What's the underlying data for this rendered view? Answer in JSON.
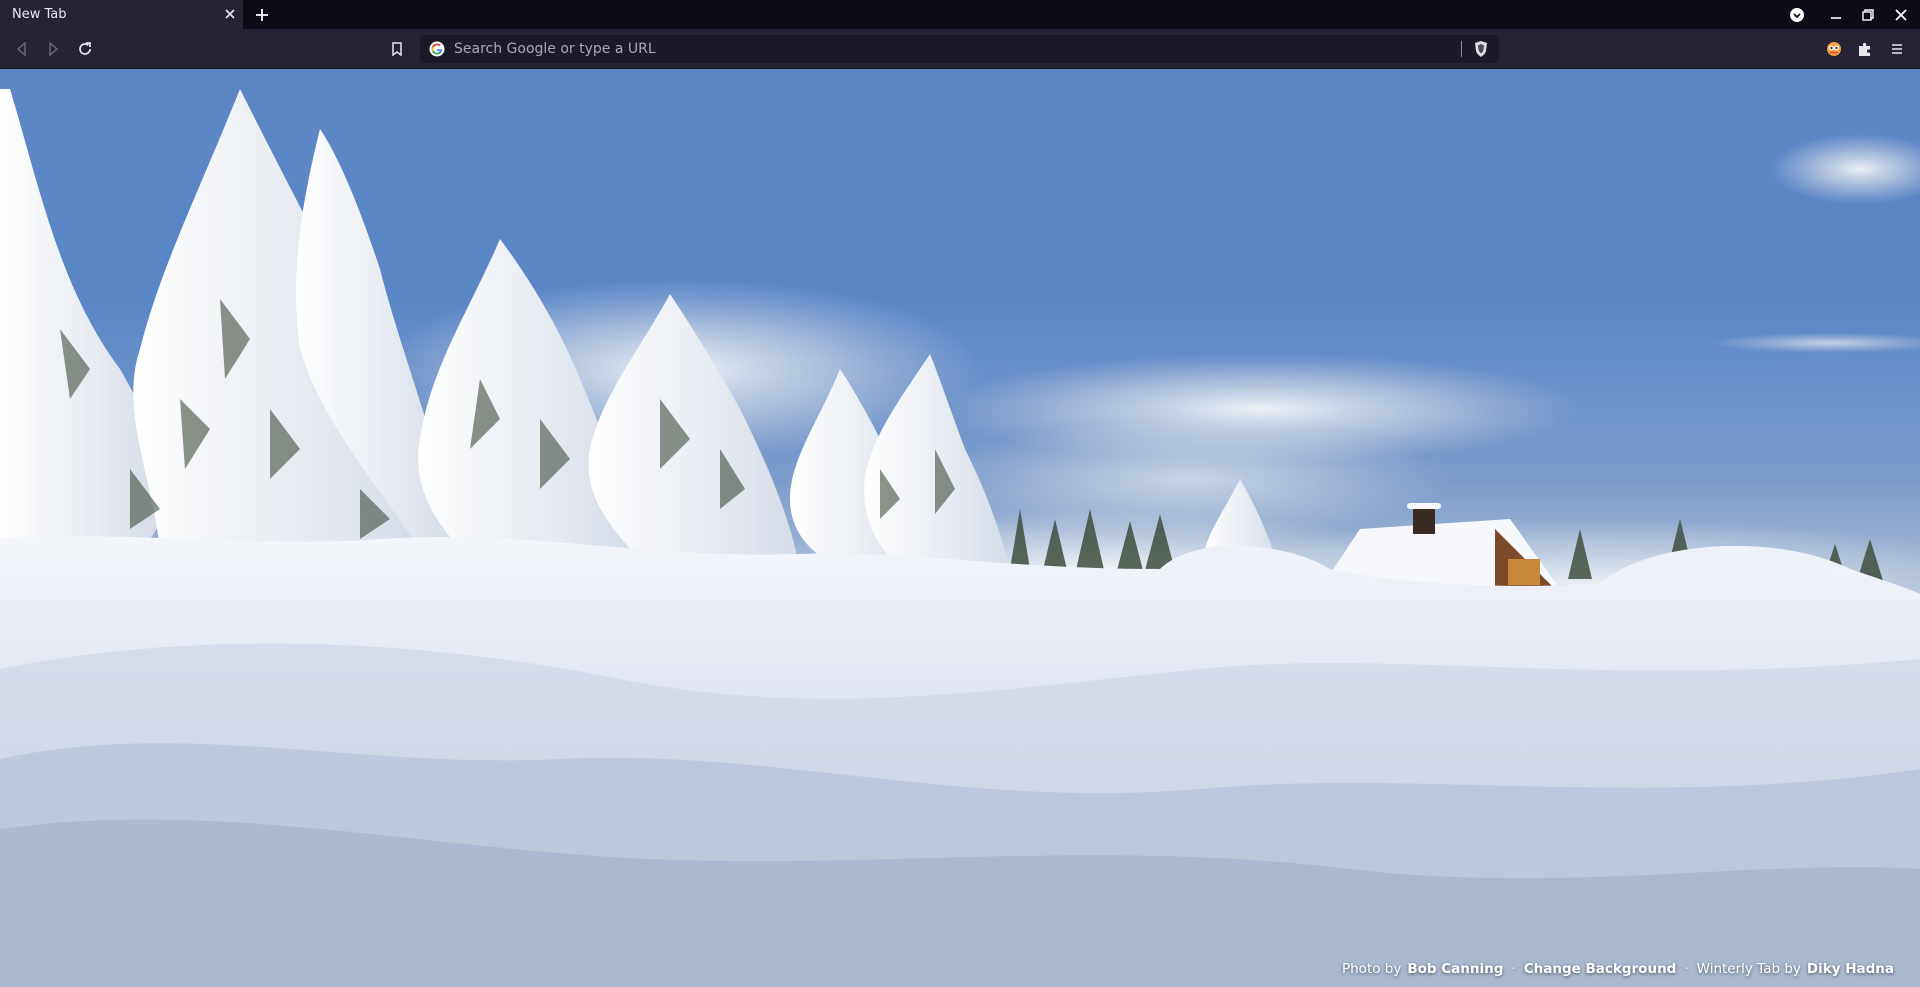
{
  "tabs": [
    {
      "title": "New Tab",
      "active": true
    }
  ],
  "omnibox": {
    "placeholder": "Search Google or type a URL",
    "value": ""
  },
  "credits": {
    "photo_prefix": "Photo by",
    "photographer": "Bob Canning",
    "change_background": "Change Background",
    "theme_prefix": "Winterly Tab by",
    "theme_author": "Diky Hadna",
    "separator": "·"
  },
  "icons": {
    "tab_close": "close-icon",
    "new_tab": "plus-icon",
    "tab_search": "chevron-down-icon",
    "minimize": "minimize-icon",
    "restore": "restore-icon",
    "close_window": "close-icon",
    "back": "back-arrow-icon",
    "forward": "forward-arrow-icon",
    "reload": "reload-icon",
    "bookmark": "bookmark-icon",
    "search_engine": "google-icon",
    "brave_shield": "shield-icon",
    "profile": "profile-icon",
    "extensions": "puzzle-icon",
    "menu": "hamburger-menu-icon"
  },
  "colors": {
    "tabstrip": "#0c0b16",
    "toolbar": "#262434",
    "omnibox": "#1b1a27"
  }
}
